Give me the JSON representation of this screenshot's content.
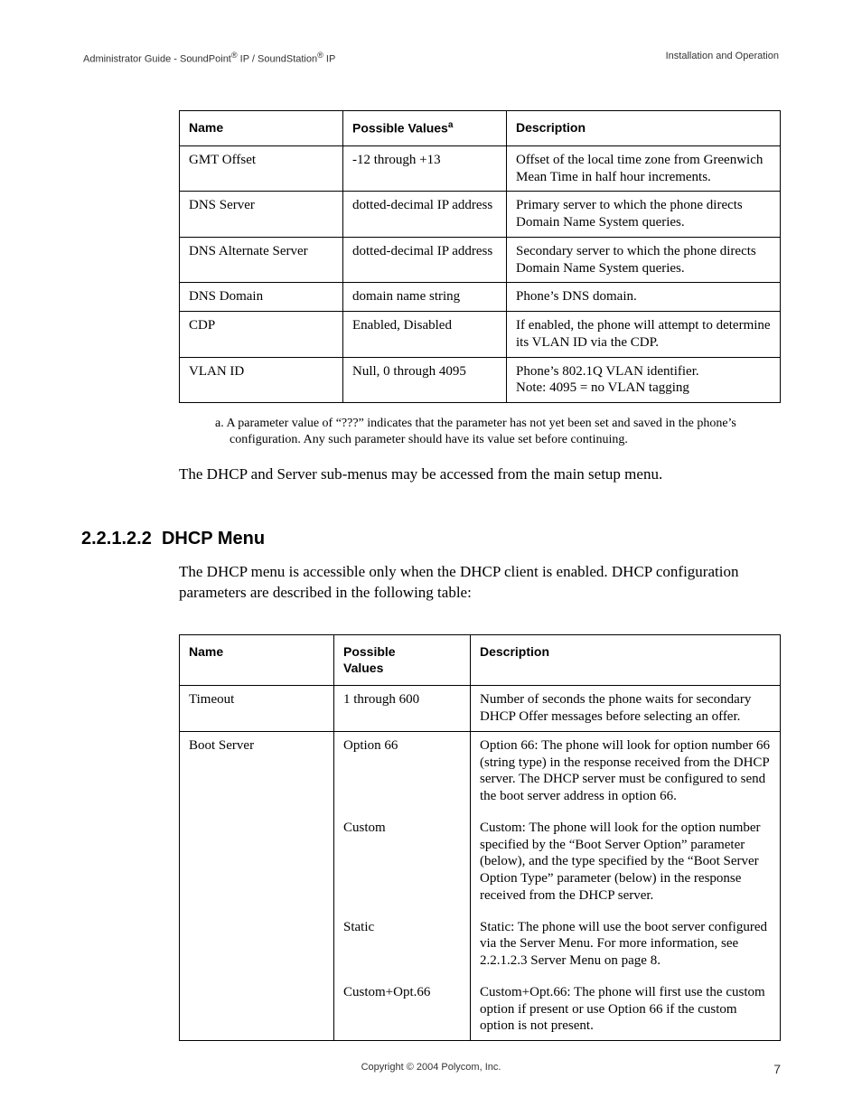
{
  "header": {
    "left_pre": "Administrator Guide - SoundPoint",
    "left_mid": " IP / SoundStation",
    "left_post": " IP",
    "right": "Installation and Operation"
  },
  "table1": {
    "headers": {
      "name": "Name",
      "values_pre": "Possible Values",
      "values_sup": "a",
      "desc": "Description"
    },
    "rows": [
      {
        "name": "GMT Offset",
        "values": "-12 through +13",
        "desc": "Offset of the local time zone from Greenwich Mean Time in half hour increments."
      },
      {
        "name": "DNS Server",
        "values": "dotted-decimal IP address",
        "desc": "Primary server to which the phone directs Domain Name System queries."
      },
      {
        "name": "DNS Alternate Server",
        "values": "dotted-decimal IP address",
        "desc": "Secondary server to which the phone directs Domain Name System queries."
      },
      {
        "name": "DNS Domain",
        "values": "domain name string",
        "desc": "Phone’s DNS domain."
      },
      {
        "name": "CDP",
        "values": "Enabled, Disabled",
        "desc": "If enabled, the phone will attempt to determine its VLAN ID via the CDP."
      },
      {
        "name": "VLAN ID",
        "values": "Null, 0 through 4095",
        "desc": "Phone’s 802.1Q VLAN identifier.\nNote: 4095 = no VLAN tagging"
      }
    ],
    "footnote": "a.  A parameter value of “???” indicates that the parameter has not yet been set and saved in the phone’s configuration.  Any such parameter should have its value set before continuing."
  },
  "para1": "The DHCP and Server sub-menus may be accessed from the main setup menu.",
  "section": {
    "num": "2.2.1.2.2",
    "title": "DHCP Menu"
  },
  "para2": "The DHCP menu is accessible only when the DHCP client is enabled.  DHCP configuration parameters are described in the following table:",
  "table2": {
    "headers": {
      "name": "Name",
      "values": "Possible Values",
      "desc": "Description"
    },
    "rows": [
      {
        "name": "Timeout",
        "values": "1 through 600",
        "desc": "Number of seconds the phone waits for secondary DHCP Offer messages before selecting an offer."
      },
      {
        "name": "Boot Server",
        "values": "Option 66",
        "desc": "Option 66:  The phone will look for option number 66 (string type) in the response received from the DHCP server.  The DHCP server must be configured to send the boot server address in option 66."
      },
      {
        "name": "",
        "values": "Custom",
        "desc": "Custom:  The phone will look for the option number specified by the “Boot Server Option” parameter (below), and the type specified by the “Boot Server Option Type” parameter (below) in the response received from the DHCP server."
      },
      {
        "name": "",
        "values": "Static",
        "desc": "Static:  The phone will use the boot server configured via the Server Menu.  For more information, see 2.2.1.2.3 Server Menu on page 8."
      },
      {
        "name": "",
        "values": "Custom+Opt.66",
        "desc": "Custom+Opt.66:  The phone will first use the custom option if present or use Option 66 if the custom option is not present."
      }
    ]
  },
  "footer": {
    "copyright": "Copyright © 2004 Polycom, Inc.",
    "page": "7"
  }
}
